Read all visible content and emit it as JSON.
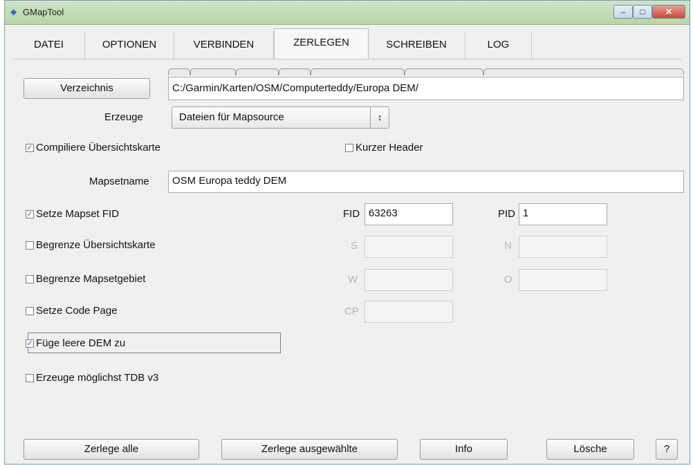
{
  "window": {
    "title": "GMapTool",
    "close_glyph": "✕",
    "minimize_glyph": "–",
    "maximize_glyph": "□"
  },
  "tabs": [
    {
      "label": "DATEI"
    },
    {
      "label": "OPTIONEN"
    },
    {
      "label": "VERBINDEN"
    },
    {
      "label": "ZERLEGEN"
    },
    {
      "label": "SCHREIBEN"
    },
    {
      "label": "LOG"
    }
  ],
  "active_tab": "ZERLEGEN",
  "directory": {
    "button_label": "Verzeichnis",
    "path": "C:/Garmin/Karten/OSM/Computerteddy/Europa DEM/"
  },
  "erzeuge": {
    "label": "Erzeuge",
    "selected": "Dateien für Mapsource"
  },
  "options": {
    "compile_overview": {
      "label": "Compiliere Übersichtskarte",
      "checked": true
    },
    "short_header": {
      "label": "Kurzer Header",
      "checked": false
    },
    "set_mapset_fid": {
      "label": "Setze Mapset FID",
      "checked": true
    },
    "limit_overview": {
      "label": "Begrenze Übersichtskarte",
      "checked": false
    },
    "limit_mapset_area": {
      "label": "Begrenze Mapsetgebiet",
      "checked": false
    },
    "set_code_page": {
      "label": "Setze Code Page",
      "checked": false
    },
    "add_empty_dem": {
      "label": "Füge leere DEM zu",
      "checked": true
    },
    "create_tdb_v3": {
      "label": "Erzeuge möglichst TDB v3",
      "checked": false
    }
  },
  "mapsetname": {
    "label": "Mapsetname",
    "value": "OSM Europa teddy DEM"
  },
  "fid": {
    "label": "FID",
    "value": "63263"
  },
  "pid": {
    "label": "PID",
    "value": "1"
  },
  "s": {
    "label": "S",
    "value": ""
  },
  "n": {
    "label": "N",
    "value": ""
  },
  "w": {
    "label": "W",
    "value": ""
  },
  "o": {
    "label": "O",
    "value": ""
  },
  "cp": {
    "label": "CP",
    "value": ""
  },
  "check_glyph": "✓",
  "buttons": {
    "split_all": "Zerlege alle",
    "split_selected": "Zerlege ausgewählte",
    "info": "Info",
    "delete": "Lösche",
    "help": "?"
  }
}
